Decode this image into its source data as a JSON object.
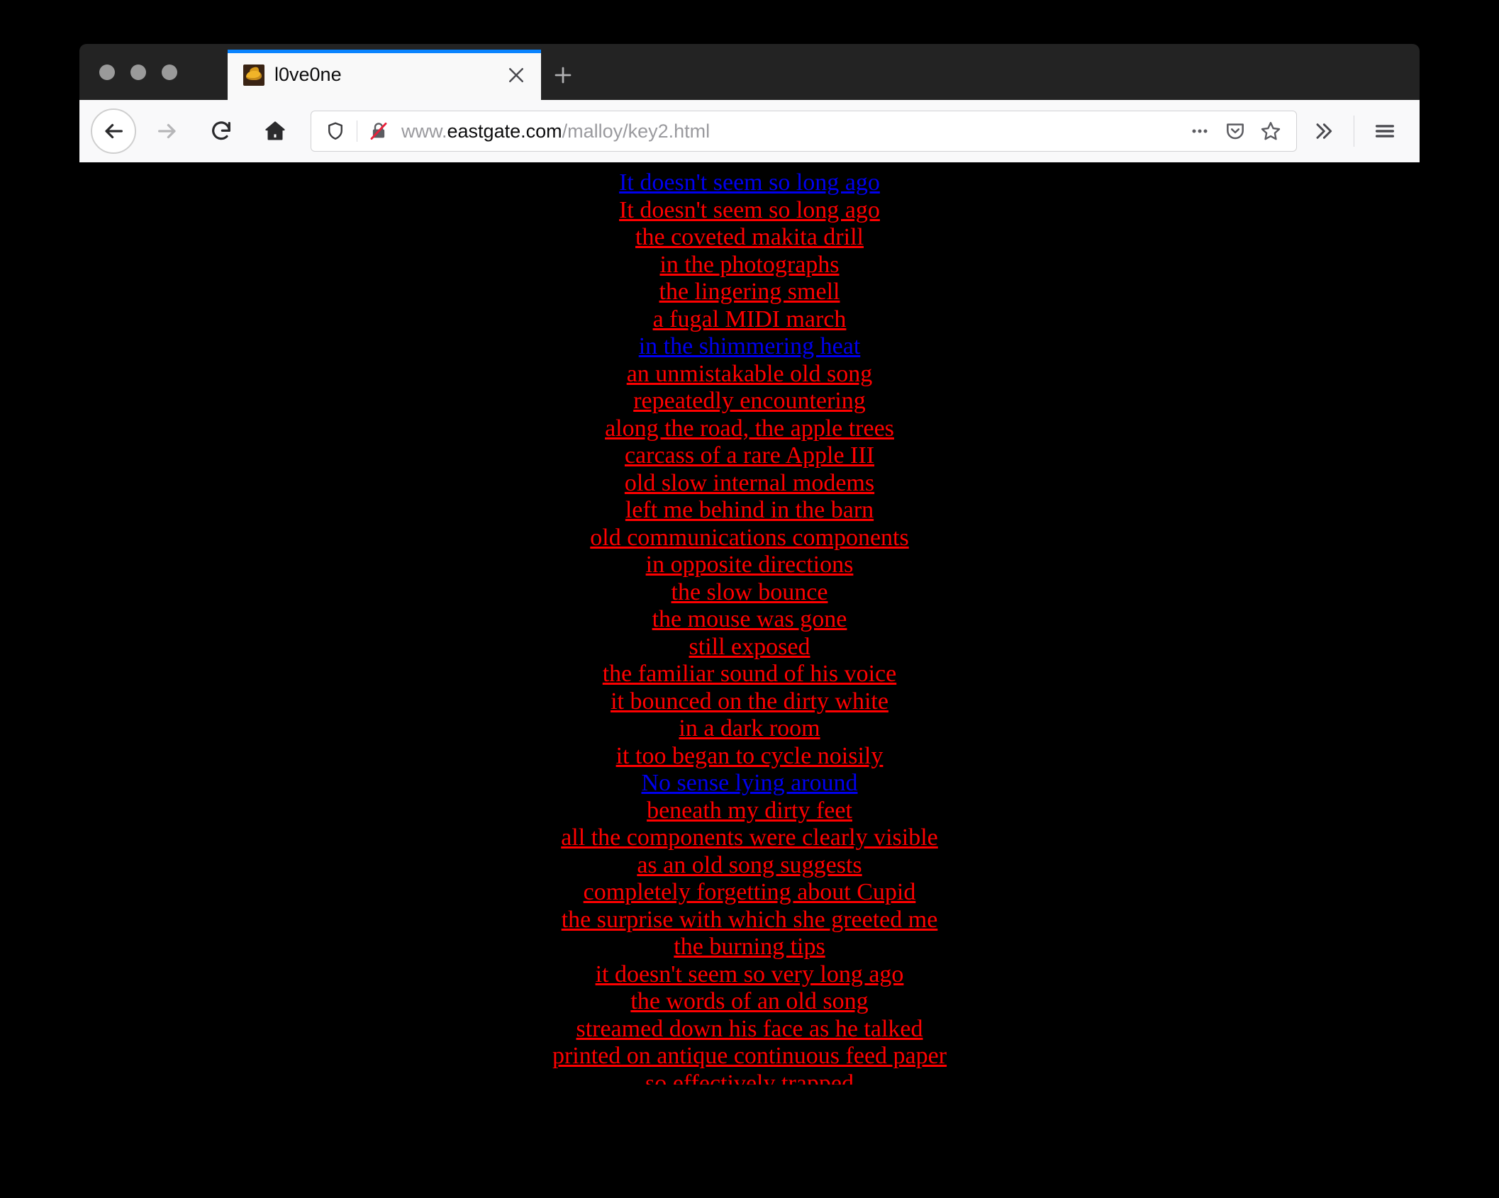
{
  "window": {
    "traffic_lights": [
      "close",
      "minimize",
      "maximize"
    ]
  },
  "tab": {
    "title": "l0ve0ne",
    "favicon_name": "flame-favicon",
    "close_label": "×",
    "new_tab_label": "+"
  },
  "toolbar": {
    "back_label": "Back",
    "forward_label": "Forward",
    "reload_label": "Reload",
    "home_label": "Home",
    "page_actions_label": "…",
    "pocket_label": "Save to Pocket",
    "bookmark_label": "Bookmark this page",
    "overflow_label": "»",
    "menu_label": "Open menu"
  },
  "url": {
    "prefix": "www.",
    "host": "eastgate.com",
    "path": "/malloy/key2.html",
    "full": "www.eastgate.com/malloy/key2.html",
    "security": "insecure-connection",
    "tracking_protection": "shield-icon"
  },
  "page": {
    "background_color": "#000000",
    "link_unvisited_color": "#0000ee",
    "link_visited_color": "#ff0000",
    "lines": [
      {
        "text": "It doesn't seem so long ago",
        "state": "unvisited"
      },
      {
        "text": "It doesn't seem so long ago",
        "state": "visited"
      },
      {
        "text": "the coveted makita drill",
        "state": "visited"
      },
      {
        "text": "in the photographs",
        "state": "visited"
      },
      {
        "text": "the lingering smell",
        "state": "visited"
      },
      {
        "text": "a fugal MIDI march",
        "state": "visited"
      },
      {
        "text": "in the shimmering heat",
        "state": "unvisited"
      },
      {
        "text": "an unmistakable old song",
        "state": "visited"
      },
      {
        "text": "repeatedly encountering",
        "state": "visited"
      },
      {
        "text": "along the road, the apple trees",
        "state": "visited"
      },
      {
        "text": "carcass of a rare Apple III",
        "state": "visited"
      },
      {
        "text": "old slow internal modems",
        "state": "visited"
      },
      {
        "text": "left me behind in the barn",
        "state": "visited"
      },
      {
        "text": "old communications components",
        "state": "visited"
      },
      {
        "text": "in opposite directions",
        "state": "visited"
      },
      {
        "text": "the slow bounce",
        "state": "visited"
      },
      {
        "text": "the mouse was gone",
        "state": "visited"
      },
      {
        "text": "still exposed",
        "state": "visited"
      },
      {
        "text": "the familiar sound of his voice",
        "state": "visited"
      },
      {
        "text": "it bounced on the dirty white",
        "state": "visited"
      },
      {
        "text": "in a dark room",
        "state": "visited"
      },
      {
        "text": "it too began to cycle noisily",
        "state": "visited"
      },
      {
        "text": "No sense lying around",
        "state": "unvisited"
      },
      {
        "text": "beneath my dirty feet",
        "state": "visited"
      },
      {
        "text": "all the components were clearly visible",
        "state": "visited"
      },
      {
        "text": "as an old song suggests",
        "state": "visited"
      },
      {
        "text": "completely forgetting about Cupid",
        "state": "visited"
      },
      {
        "text": "the surprise with which she greeted me",
        "state": "visited"
      },
      {
        "text": "the burning tips",
        "state": "visited"
      },
      {
        "text": "it doesn't seem so very long ago",
        "state": "visited"
      },
      {
        "text": "the words of an old song",
        "state": "visited"
      },
      {
        "text": "streamed down his face as he talked",
        "state": "visited"
      },
      {
        "text": "printed on antique continuous feed paper",
        "state": "visited"
      },
      {
        "text": "so effectively trapped",
        "state": "visited"
      }
    ]
  }
}
